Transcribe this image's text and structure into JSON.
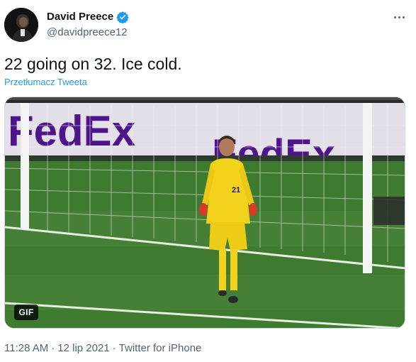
{
  "author": {
    "display_name": "David Preece",
    "handle": "@davidpreece12",
    "verified": true
  },
  "tweet": {
    "text": "22 going on 32. Ice cold.",
    "translate_link": "Przetłumacz Tweeta"
  },
  "media": {
    "badge": "GIF",
    "banner_text": "FedEx",
    "jersey_number": "21"
  },
  "meta": {
    "time": "11:28 AM",
    "separator": "·",
    "date": "12 lip 2021",
    "source": "Twitter for iPhone"
  },
  "colors": {
    "link": "#1d9bf0",
    "verified_badge": "#1d9bf0",
    "secondary_text": "#536471",
    "fedex_purple": "#4d148c",
    "fedex_orange": "#ff6200",
    "pitch_green": "#3f7a31",
    "kit_yellow": "#f2d21b"
  },
  "icons": {
    "verified": "verified-badge-icon",
    "more": "more-options-icon"
  }
}
